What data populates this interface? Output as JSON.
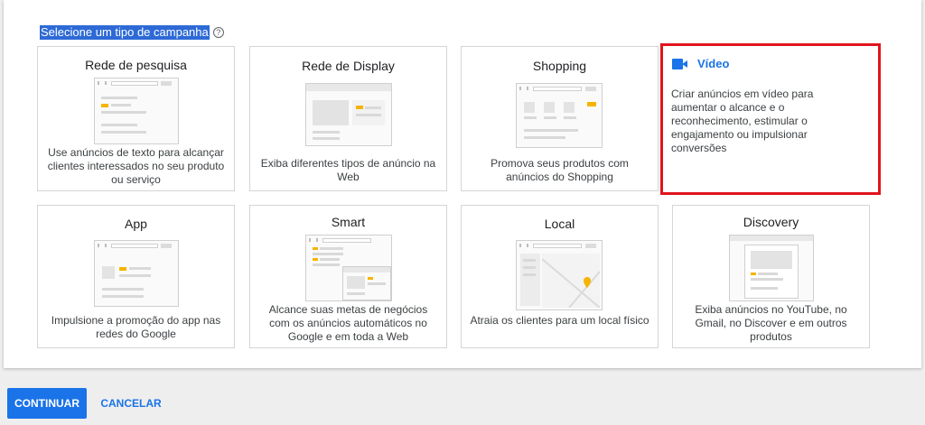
{
  "heading": {
    "text": "Selecione um tipo de campanha",
    "help_icon": "?"
  },
  "cards": [
    {
      "title": "Rede de pesquisa",
      "description": "Use anúncios de texto para alcançar clientes interessados no seu produto ou serviço"
    },
    {
      "title": "Rede de Display",
      "description": "Exiba diferentes tipos de anúncio na Web"
    },
    {
      "title": "Shopping",
      "description": "Promova seus produtos com anúncios do Shopping"
    },
    {
      "title": "Vídeo",
      "description": "Criar anúncios em vídeo para aumentar o alcance e o reconhecimento, estimular o engajamento ou impulsionar conversões",
      "icon": "video-camera-icon",
      "selected": true
    },
    {
      "title": "App",
      "description": "Impulsione a promoção do app nas redes do Google"
    },
    {
      "title": "Smart",
      "description": "Alcance suas metas de negócios com os anúncios automáticos no Google e em toda a Web"
    },
    {
      "title": "Local",
      "description": "Atraia os clientes para um local físico"
    },
    {
      "title": "Discovery",
      "description": "Exiba anúncios no YouTube, no Gmail, no Discover e em outros produtos"
    }
  ],
  "actions": {
    "continue_label": "CONTINUAR",
    "cancel_label": "CANCELAR"
  },
  "colors": {
    "accent": "#1a73e8",
    "selection_border": "#e1141d",
    "heading_highlight": "#2e6ad6",
    "illustration_highlight": "#f6b400"
  }
}
